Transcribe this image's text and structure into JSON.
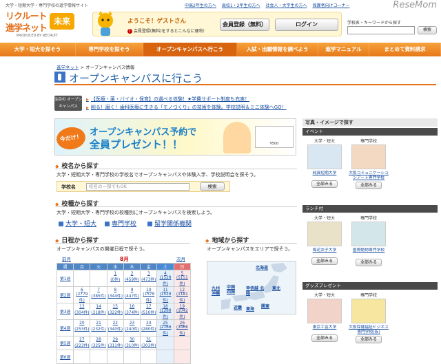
{
  "header": {
    "tagline": "大学・短期大学・専門学校の進学情報サイト",
    "logo_line1": "リクルート",
    "logo_line2": "進学ネット",
    "logo_mirai": "未来",
    "logo_sub": "PRODUCED BY RECRUIT",
    "top_links": [
      "中高2年生の方へ",
      "高校1・2年生の方へ",
      "社会人・大学生の方へ",
      "保護者向けコーナー"
    ],
    "welcome_title": "ようこそ！ゲストさん",
    "welcome_sub": "会員登録(無料)をするとこんなに便利!",
    "register_button": "会員登録（無料）",
    "login_button": "ログイン",
    "watermark": "ReseMom",
    "search_label": "学校名・キーワードから探す",
    "search_button": "検索"
  },
  "nav": [
    "大学・短大を探そう",
    "専門学校を探そう",
    "オープンキャンパスへ行こう",
    "入試・出願情報を調べよう",
    "進学マニュアル",
    "まとめて資料請求"
  ],
  "breadcrumb": {
    "home": "進学ネット",
    "sep": ">",
    "current": "オープンキャンパス情報"
  },
  "page_title": "オープンキャンパスに行こう",
  "notice": {
    "label": "注目の オープンキャンパス",
    "item1": "【医療・薬・バイオ・保育】の選べる体験！★学費サポート制度も充実！",
    "item2": "削る！磨く！歯科医療に生きる「モノづくり」の技術を体験。学校説明＆ミニ体験へGO！"
  },
  "banner": {
    "badge": "今だけ！",
    "line1": "オープンキャンパス予約で",
    "line2": "全員プレゼント！！",
    "card_text": "¥500"
  },
  "school_search": {
    "heading": "校名から探す",
    "desc": "大学・短期大学・専門学校の学校名でオープンキャンパスや体験入学、学校説明会を探そう。",
    "label": "学校名",
    "placeholder": "校名の一部でもOK",
    "button": "検索"
  },
  "type_search": {
    "heading": "校種から探す",
    "desc": "大学・短期大学・専門学校の校種別にオープンキャンパスを検索しよう。",
    "types": [
      "大学・短大",
      "専門学校",
      "留学関係機関"
    ]
  },
  "date_search": {
    "heading": "日程から探す",
    "desc": "オープンキャンパスの開催日程で探そう。",
    "prev": "前月",
    "month": "8月",
    "next": "次月",
    "weekdays": [
      "週",
      "月",
      "火",
      "水",
      "木",
      "金",
      "土",
      "日"
    ],
    "rows": [
      {
        "week": "第1週",
        "days": [
          [
            "",
            ""
          ],
          [
            "",
            ""
          ],
          [
            "1",
            "(0件)"
          ],
          [
            "2",
            "(459件)"
          ],
          [
            "3",
            "(473件)"
          ],
          [
            "4",
            "(1528件)"
          ],
          [
            "5",
            "(5151件)"
          ]
        ]
      },
      {
        "week": "第2週",
        "days": [
          [
            "6",
            "(2779件)"
          ],
          [
            "7",
            "(385件)"
          ],
          [
            "8",
            "(344件)"
          ],
          [
            "9",
            "(447件)"
          ],
          [
            "10",
            "(1578件)"
          ],
          [
            "11",
            "(1528件)"
          ],
          [
            "12",
            "(1181件)"
          ]
        ]
      },
      {
        "week": "第3週",
        "days": [
          [
            "13",
            "(304件)"
          ],
          [
            "14",
            "(318件)"
          ],
          [
            "15",
            "(322件)"
          ],
          [
            "16",
            "(374件)"
          ],
          [
            "17",
            "(510件)"
          ],
          [
            "18",
            "(1288件)"
          ],
          [
            "19",
            "(1042件)"
          ]
        ]
      },
      {
        "week": "第4週",
        "days": [
          [
            "20",
            "(253件)"
          ],
          [
            "21",
            "(232件)"
          ],
          [
            "22",
            "(340件)"
          ],
          [
            "23",
            "(240件)"
          ],
          [
            "24",
            "(280件)"
          ],
          [
            "25",
            "(2166件)"
          ],
          [
            "26",
            "(3466件)"
          ]
        ]
      },
      {
        "week": "第5週",
        "days": [
          [
            "27",
            "(223件)"
          ],
          [
            "28",
            "(325件)"
          ],
          [
            "29",
            "(311件)"
          ],
          [
            "30",
            "(310件)"
          ],
          [
            "31",
            "(303件)"
          ],
          [
            "",
            ""
          ],
          [
            "",
            ""
          ]
        ]
      },
      {
        "week": "第6週",
        "days": [
          [
            "",
            ""
          ],
          [
            "",
            ""
          ],
          [
            "",
            ""
          ],
          [
            "",
            ""
          ],
          [
            "",
            ""
          ],
          [
            "",
            ""
          ],
          [
            "",
            ""
          ]
        ]
      }
    ]
  },
  "area_search": {
    "heading": "地域から探す",
    "desc": "オープンキャンパスをエリアで探そう。",
    "regions": [
      "北海道",
      "東北",
      "甲信越 北陸",
      "関東",
      "東海",
      "近畿",
      "中国 四国",
      "九州 沖縄"
    ]
  },
  "photo_search": {
    "heading": "写真・イメージで探す",
    "cat_univ": "大学・短大",
    "cat_voc": "専門学校",
    "see_all": "全部みる",
    "sections": [
      {
        "title": "イベント",
        "univ_caption": "純真短期大学",
        "voc_caption": "大阪コミュニケーションアート専門学校"
      },
      {
        "title": "ランチ付",
        "univ_caption": "梅花女子大学",
        "voc_caption": "国際動物専門学校"
      },
      {
        "title": "グッズプレゼント",
        "univ_caption": "東京工芸大学",
        "voc_caption": "大阪保健福祉ビジネス専門学校(仮)"
      }
    ]
  }
}
